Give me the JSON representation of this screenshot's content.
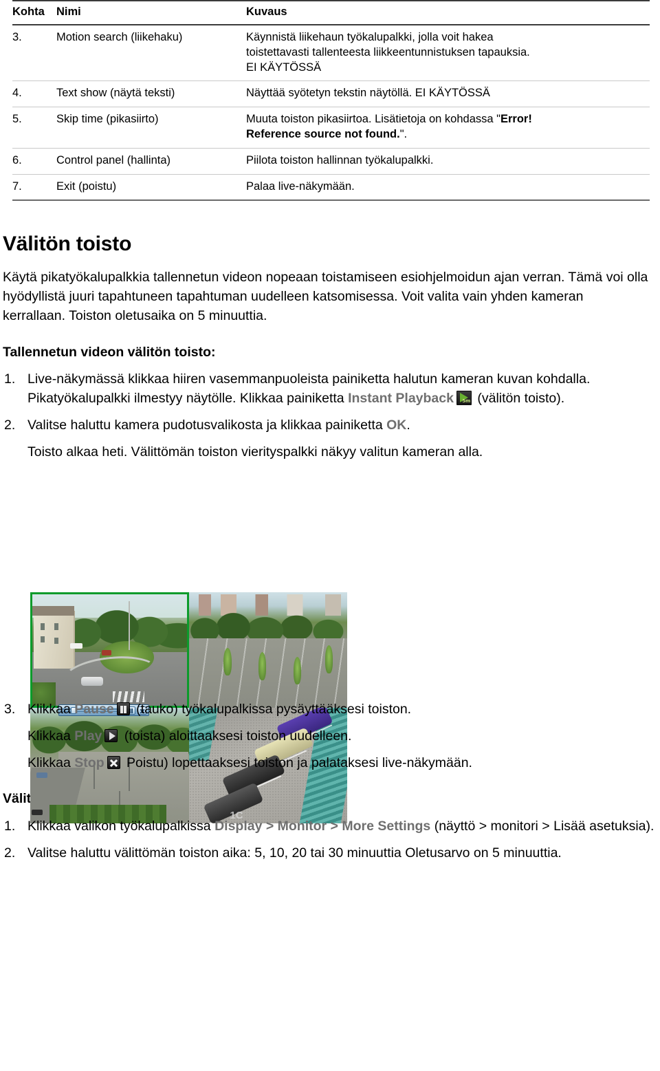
{
  "table": {
    "headers": [
      "Kohta",
      "Nimi",
      "Kuvaus"
    ],
    "rows": [
      {
        "num": "3.",
        "name": "Motion search (liikehaku)",
        "desc_line1": "Käynnistä liikehaun työkalupalkki, jolla voit hakea",
        "desc_line2": "toistettavasti tallenteesta liikkeentunnistuksen tapauksia.",
        "desc_line3": "EI KÄYTÖSSÄ"
      },
      {
        "num": "4.",
        "name": "Text show (näytä teksti)",
        "desc_line1": "Näyttää syötetyn tekstin näytöllä. EI KÄYTÖSSÄ",
        "desc_line2": "",
        "desc_line3": ""
      },
      {
        "num": "5.",
        "name": "Skip time (pikasiirto)",
        "desc_pre": "Muuta toiston pikasiirtoa. Lisätietoja on kohdassa \"",
        "desc_bold1": "Error!",
        "desc_bold2": "Reference source not found.",
        "desc_post": "\"."
      },
      {
        "num": "6.",
        "name": "Control panel (hallinta)",
        "desc_line1": "Piilota toiston hallinnan työkalupalkki.",
        "desc_line2": "",
        "desc_line3": ""
      },
      {
        "num": "7.",
        "name": "Exit (poistu)",
        "desc_line1": "Palaa live-näkymään.",
        "desc_line2": "",
        "desc_line3": ""
      }
    ]
  },
  "section": {
    "heading": "Välitön toisto",
    "intro": "Käytä pikatyökalupalkkia tallennetun videon nopeaan toistamiseen esiohjelmoidun ajan verran. Tämä voi olla hyödyllistä juuri tapahtuneen tapahtuman uudelleen katsomisessa. Voit valita vain yhden kameran kerrallaan. Toiston oletusaika on 5 minuuttia.",
    "subheading": "Tallennetun videon välitön toisto:"
  },
  "steps_playback": [
    {
      "marker": "1.",
      "text_pre": "Live-näkymässä klikkaa hiiren vasemmanpuoleista painiketta halutun kameran kuvan kohdalla. Pikatyökalupalkki ilmestyy näytölle. Klikkaa painiketta ",
      "emphasis": "Instant Playback",
      "icon": "instant-playback-icon",
      "icon_label": "5m",
      "text_post": " (välitön toisto)."
    },
    {
      "marker": "2.",
      "text_pre": "Valitse haluttu kamera pudotusvalikosta ja klikkaa painiketta ",
      "emphasis": "OK",
      "text_post": ".",
      "sub": "Toisto alkaa heti. Välittömän toiston vierityspalkki näkyy valitun kameran alla."
    }
  ],
  "step3": {
    "marker": "3.",
    "pause_pre": "Klikkaa ",
    "pause_label": "Pause",
    "pause_icon": "pause-icon",
    "pause_post": " (tauko) työkalupalkissa pysäyttääksesi toiston.",
    "play_pre": "Klikkaa ",
    "play_label": "Play",
    "play_icon": "play-icon",
    "play_post": " (toista) aloittaaksesi toiston uudelleen.",
    "stop_pre": "Klikkaa ",
    "stop_label": "Stop",
    "stop_icon": "stop-icon",
    "stop_post": " Poistu) lopettaaksesi toiston ja palataksesi live-näkymään."
  },
  "section2": {
    "heading": "Välittömän toiston ajan muuttaminen:",
    "steps": [
      {
        "marker": "1.",
        "text_pre": "Klikkaa valikon työkalupalkissa ",
        "emphasis": "Display > Monitor > More Settings",
        "text_post": " (näyttö > monitori > Lisää asetuksia)."
      },
      {
        "marker": "2.",
        "text_pre": "Valitse haluttu välittömän toiston aika: 5, 10, 20 tai 30 minuuttia Oletusarvo on 5 minuuttia.",
        "emphasis": "",
        "text_post": ""
      }
    ]
  },
  "screenshot": {
    "caption_tag": "1C",
    "selected_pane": "top-left",
    "selection_color": "#0b9b2b",
    "scrubber": {
      "pause_button": "pause",
      "stop_button": "stop"
    }
  },
  "colors": {
    "emphasis_gray": "#6f6f6f",
    "icon_green": "#68b030",
    "rule_dark": "#3a3a3a",
    "rule_light": "#c9c9c9"
  }
}
